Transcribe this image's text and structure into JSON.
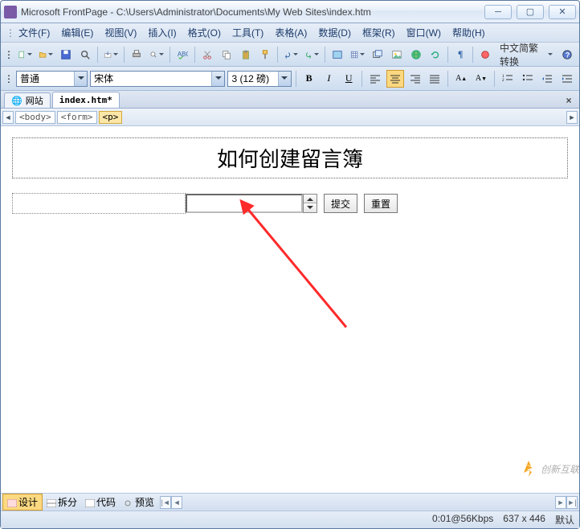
{
  "title": "Microsoft FrontPage - C:\\Users\\Administrator\\Documents\\My Web Sites\\index.htm",
  "menu": [
    "文件(F)",
    "编辑(E)",
    "视图(V)",
    "插入(I)",
    "格式(O)",
    "工具(T)",
    "表格(A)",
    "数据(D)",
    "框架(R)",
    "窗口(W)",
    "帮助(H)"
  ],
  "convert_label": "中文简繁转换",
  "style_combo": "普通",
  "font_combo": "宋体",
  "size_combo": "3 (12 磅)",
  "tabs": {
    "site": "网站",
    "file": "index.htm*"
  },
  "crumbs": [
    "<body>",
    "<form>",
    "<p>"
  ],
  "heading": "如何创建留言簿",
  "btn_submit": "提交",
  "btn_reset": "重置",
  "views": {
    "design": "设计",
    "split": "拆分",
    "code": "代码",
    "preview": "预览"
  },
  "status": {
    "speed": "0:01@56Kbps",
    "size": "637 x 446",
    "mode": "默认"
  },
  "watermark": "创新互联"
}
